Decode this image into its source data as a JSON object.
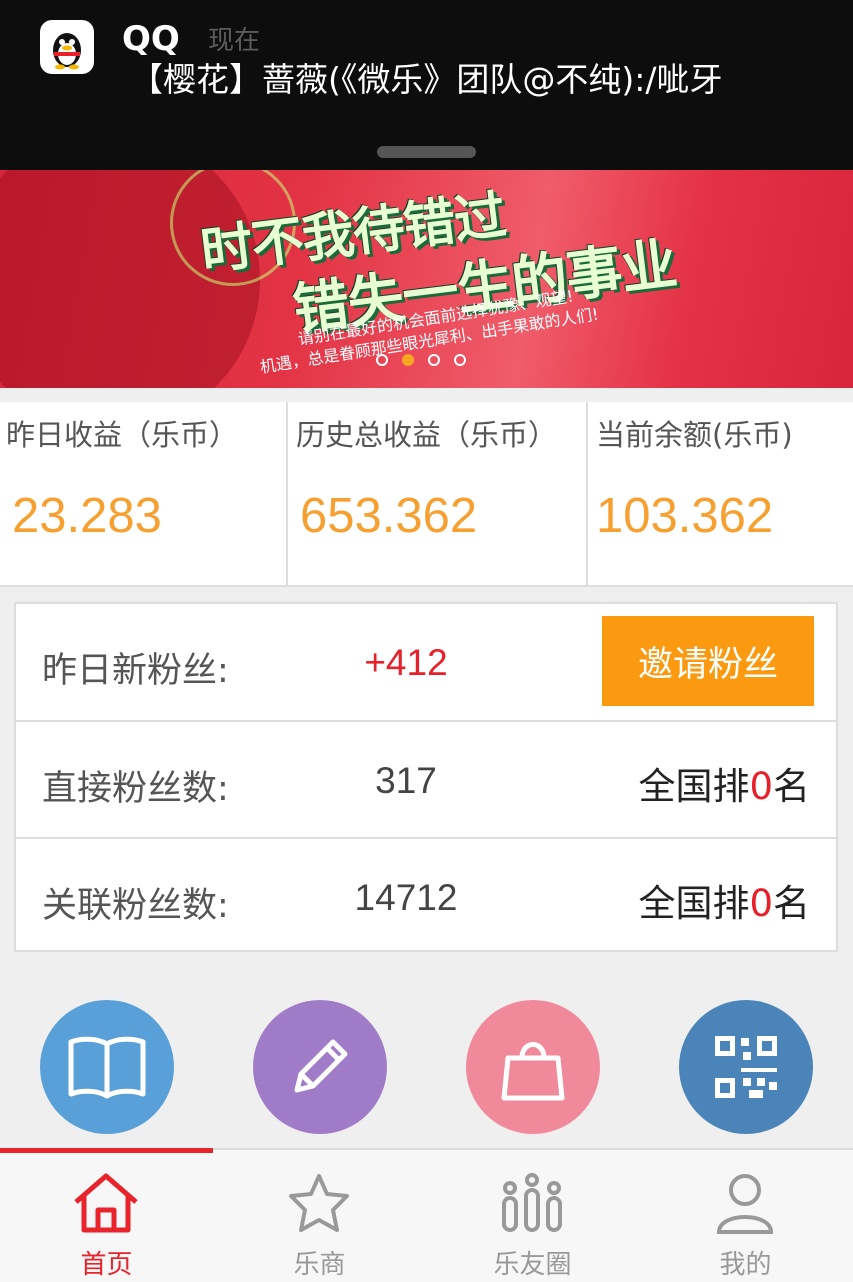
{
  "notification": {
    "app_name": "QQ",
    "time": "现在",
    "message": "【樱花】蔷薇(《微乐》团队@不纯):/呲牙"
  },
  "banner": {
    "headline_1": "时不我待错过",
    "headline_2": "错失一生的事业",
    "sub_1": "请别在最好的机会面前选择犹豫、观望!",
    "sub_2": "机遇，总是眷顾那些眼光犀利、出手果敢的人们!",
    "dots": 4,
    "active_dot": 2
  },
  "stats": [
    {
      "label": "昨日收益（乐币）",
      "value": "23.283"
    },
    {
      "label": "历史总收益（乐币）",
      "value": "653.362"
    },
    {
      "label": "当前余额(乐币)",
      "value": "103.362"
    }
  ],
  "fans": {
    "new_label": "昨日新粉丝:",
    "new_value": "+412",
    "invite_button": "邀请粉丝",
    "direct_label": "直接粉丝数:",
    "direct_value": "317",
    "related_label": "关联粉丝数:",
    "related_value": "14712",
    "rank_prefix": "全国排",
    "rank_direct": "0",
    "rank_related": "0",
    "rank_suffix": "名"
  },
  "quick_actions": [
    {
      "icon": "book-icon",
      "color": "#5aa0d8"
    },
    {
      "icon": "pencil-icon",
      "color": "#a07cc8"
    },
    {
      "icon": "bag-icon",
      "color": "#f08a9a"
    },
    {
      "icon": "qr-code-icon",
      "color": "#4a84b8"
    }
  ],
  "tabs": [
    {
      "label": "首页",
      "icon": "home-icon",
      "active": true
    },
    {
      "label": "乐商",
      "icon": "star-icon",
      "active": false
    },
    {
      "label": "乐友圈",
      "icon": "people-icon",
      "active": false
    },
    {
      "label": "我的",
      "icon": "user-icon",
      "active": false
    }
  ],
  "colors": {
    "accent": "#e8232c",
    "value_orange": "#f5a030",
    "button_orange": "#fb9a10"
  }
}
